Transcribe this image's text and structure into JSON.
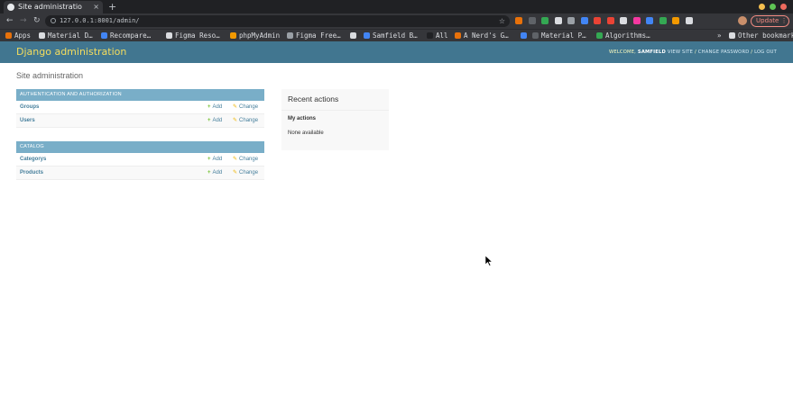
{
  "browser": {
    "tab_title": "Site administratio",
    "tab_close": "×",
    "new_tab": "+",
    "nav": {
      "back": "←",
      "forward": "→",
      "reload": "↻"
    },
    "url": "127.0.0.1:8001/admin/",
    "star": "☆",
    "update_label": "Update ⋮",
    "bookmarks": [
      {
        "label": "Apps",
        "color": "#e8710a"
      },
      {
        "label": "Material D…",
        "color": "#dadce0"
      },
      {
        "label": "Recompare…",
        "color": "#4285f4"
      },
      {
        "label": "Figma Reso…",
        "color": "#dadce0"
      },
      {
        "label": "phpMyAdmin",
        "color": "#f29900"
      },
      {
        "label": "Figma Free…",
        "color": "#9aa0a6"
      },
      {
        "label": "",
        "color": "#dadce0"
      },
      {
        "label": "Samfield B…",
        "color": "#4285f4"
      },
      {
        "label": "All",
        "color": "#202124"
      },
      {
        "label": "A Nerd's G…",
        "color": "#e8710a"
      },
      {
        "label": "",
        "color": "#4285f4"
      },
      {
        "label": "Material P…",
        "color": "#5f6368"
      },
      {
        "label": "Algorithms…",
        "color": "#34a853"
      },
      {
        "label": "»",
        "color": ""
      },
      {
        "label": "Other bookmarks",
        "color": "#dadce0"
      }
    ],
    "extension_colors": [
      "#e8710a",
      "#5f6368",
      "#34a853",
      "#dadce0",
      "#9aa0a6",
      "#4285f4",
      "#ea4335",
      "#ea4335",
      "#dadce0",
      "#f538a0",
      "#4285f4",
      "#34a853",
      "#f29900",
      "#dadce0"
    ]
  },
  "header": {
    "brand": "Django administration",
    "welcome": "WELCOME,",
    "username": "SAMFIELD",
    "view_site": "VIEW SITE",
    "change_password": "CHANGE PASSWORD",
    "log_out": "LOG OUT",
    "sep": " / "
  },
  "content": {
    "title": "Site administration",
    "add_label": "Add",
    "change_label": "Change",
    "modules": [
      {
        "caption": "AUTHENTICATION AND AUTHORIZATION",
        "models": [
          "Groups",
          "Users"
        ]
      },
      {
        "caption": "CATALOG",
        "models": [
          "Categorys",
          "Products"
        ]
      }
    ]
  },
  "recent_actions": {
    "title": "Recent actions",
    "subtitle": "My actions",
    "empty": "None available"
  }
}
